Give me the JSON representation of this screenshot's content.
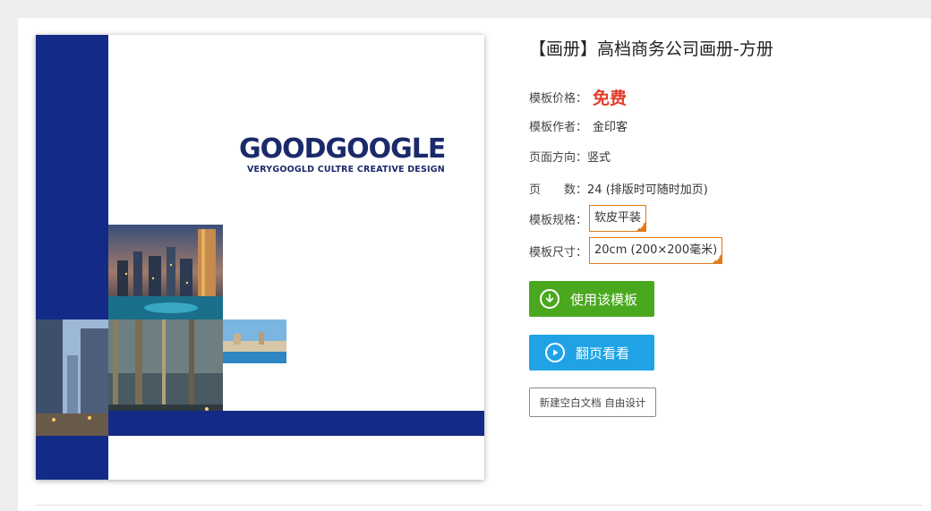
{
  "product": {
    "title": "【画册】高档商务公司画册-方册",
    "price_label": "模板价格：",
    "price_value": "免费",
    "author_label": "模板作者：",
    "author_value": "金印客",
    "orientation_label": "页面方向：",
    "orientation_value": "竖式",
    "pages_label": "页　　数：",
    "pages_value": "24 (排版时可随时加页)",
    "spec_label": "模板规格：",
    "spec_value": "软皮平装",
    "size_label": "模板尺寸：",
    "size_value": "20cm (200×200毫米)"
  },
  "actions": {
    "use_template": "使用该模板",
    "flip_preview": "翻页看看",
    "new_blank": "新建空白文档 自由设计"
  },
  "cover": {
    "brand": "GOODGOOGLE",
    "tagline": "VERYGOOGLD CULTRE CREATIVE DESIGN"
  },
  "colors": {
    "price": "#e23d2d",
    "selected_border": "#e07a1c",
    "green_button": "#4aa81e",
    "blue_button": "#1fa3e6",
    "cover_navy": "#132a86"
  },
  "icons": {
    "use_template": "download-circle-icon",
    "flip_preview": "play-circle-icon",
    "selected": "checkmark-corner-icon"
  }
}
